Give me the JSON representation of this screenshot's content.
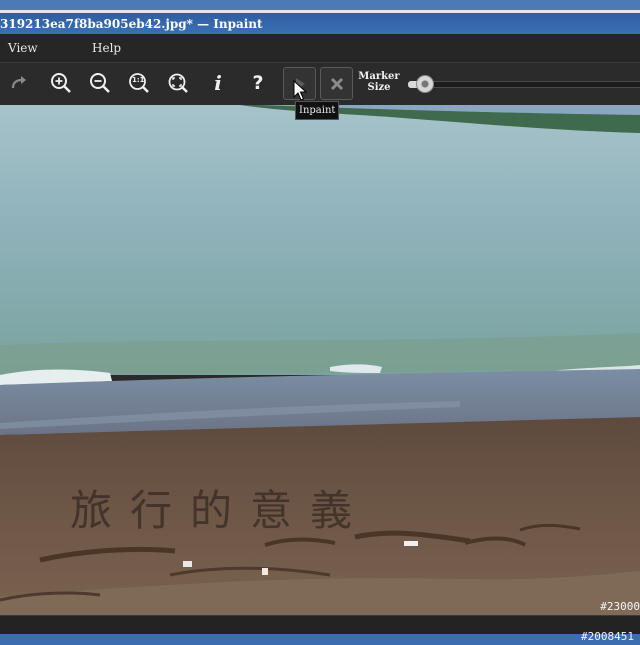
{
  "window": {
    "title": "319213ea7f8ba905eb42.jpg* — Inpaint"
  },
  "menu": {
    "items": [
      {
        "label": "View"
      },
      {
        "label": "Help"
      }
    ]
  },
  "toolbar": {
    "redo_icon": "redo-arrow-icon",
    "zoom_in_icon": "zoom-in-icon",
    "zoom_out_icon": "zoom-out-icon",
    "zoom_actual_label": "1:1",
    "fit_icon": "zoom-fit-icon",
    "info_label": "i",
    "help_label": "?",
    "inpaint_icon": "play-triangle-icon",
    "cancel_icon": "close-x-icon",
    "marker_size_label_1": "Marker",
    "marker_size_label_2": "Size",
    "marker_size_value": 0.07
  },
  "tooltip": {
    "text": "Inpaint"
  },
  "canvas": {
    "coordinate_readout": "#23000",
    "image_text": "旅行的意義"
  },
  "status": {
    "coordinate_readout": "#2008451"
  },
  "colors": {
    "title_bar": "#3a6fb4",
    "toolbar_bg": "#2b2b2b",
    "sea": "#8fb2ba",
    "sand": "#6e5747"
  }
}
